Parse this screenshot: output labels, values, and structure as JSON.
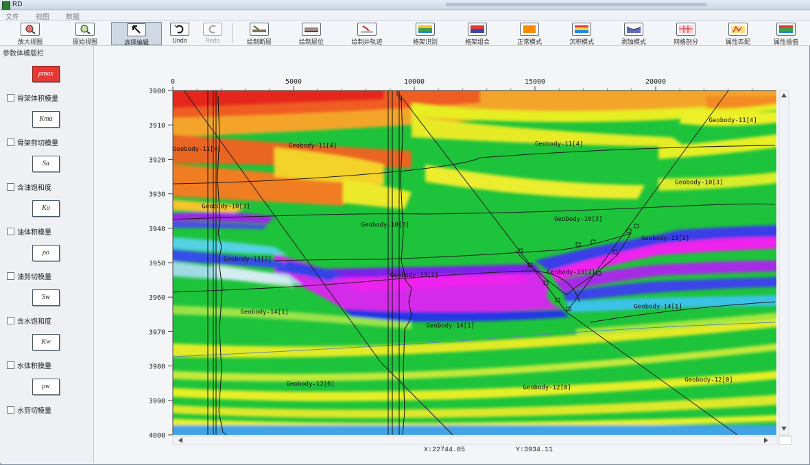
{
  "window": {
    "title": "RD"
  },
  "menu": [
    "文件",
    "视图",
    "数据"
  ],
  "toolbar": {
    "items": [
      {
        "label": "放大视图",
        "icon": "zoom-in-icon"
      },
      {
        "label": "原始视图",
        "icon": "original-view-icon"
      },
      {
        "label": "选择编辑",
        "icon": "select-arrow-icon"
      },
      {
        "label": "Undo",
        "icon": "undo-icon"
      },
      {
        "label": "Redo",
        "icon": "redo-icon"
      },
      {
        "label": "绘制断层",
        "icon": "draw-fault-icon"
      },
      {
        "label": "绘制层位",
        "icon": "draw-horizon-icon"
      },
      {
        "label": "绘制井轨迹",
        "icon": "draw-well-track-icon"
      },
      {
        "label": "格架识别",
        "icon": "framework-recognition-icon"
      },
      {
        "label": "格架组合",
        "icon": "framework-combine-icon"
      },
      {
        "label": "正常模式",
        "icon": "normal-mode-icon"
      },
      {
        "label": "沉积模式",
        "icon": "sedimentary-mode-icon"
      },
      {
        "label": "剥蚀模式",
        "icon": "erosion-mode-icon"
      },
      {
        "label": "网格剖分",
        "icon": "mesh-subdivide-icon"
      },
      {
        "label": "属性匹配",
        "icon": "attribute-match-icon"
      },
      {
        "label": "属性插值",
        "icon": "attribute-interpolate-icon"
      }
    ]
  },
  "panel": {
    "title": "参数体模版栏",
    "top_button": "ρmax",
    "items": [
      {
        "label": "骨架体积模量",
        "button": "Kma"
      },
      {
        "label": "骨架剪切模量",
        "button": "Sa"
      },
      {
        "label": "含油饱和度",
        "button": "Ko"
      },
      {
        "label": "油体积模量",
        "button": "ρo"
      },
      {
        "label": "油剪切模量",
        "button": "Sw"
      },
      {
        "label": "含水饱和度",
        "button": "Kw"
      },
      {
        "label": "水体积模量",
        "button": "ρw"
      },
      {
        "label": "水剪切模量",
        "button": ""
      }
    ]
  },
  "chart_data": {
    "type": "seismic-section",
    "x_ticks": [
      "0",
      "5000",
      "10000",
      "15000",
      "20000"
    ],
    "xlim": [
      0,
      25000
    ],
    "y_ticks": [
      "3900",
      "3910",
      "3920",
      "3930",
      "3940",
      "3950",
      "3960",
      "3970",
      "3980",
      "3990",
      "4000"
    ],
    "ylim": [
      3900,
      4000
    ],
    "geobody_labels": [
      {
        "text": "Geobody-11[4]",
        "x": 0,
        "y": 3917.5
      },
      {
        "text": "Geobody-11[4]",
        "x": 4800,
        "y": 3916.5
      },
      {
        "text": "Geobody-11[4]",
        "x": 15000,
        "y": 3916
      },
      {
        "text": "Geobody-11[4]",
        "x": 22200,
        "y": 3909.2
      },
      {
        "text": "Geobody-10[3]",
        "x": 1200,
        "y": 3934.2
      },
      {
        "text": "Geobody-10[3]",
        "x": 7800,
        "y": 3939.5
      },
      {
        "text": "Geobody-10[3]",
        "x": 15800,
        "y": 3937.8
      },
      {
        "text": "Geobody-10[3]",
        "x": 20800,
        "y": 3927.2
      },
      {
        "text": "Geobody-13[2]",
        "x": 2100,
        "y": 3949.5
      },
      {
        "text": "Geobody-13[2]",
        "x": 9000,
        "y": 3954.2
      },
      {
        "text": "Geobody-13[2]",
        "x": 15500,
        "y": 3953.3
      },
      {
        "text": "Geobody-13[2]",
        "x": 19400,
        "y": 3943.4
      },
      {
        "text": "Geobody-14[1]",
        "x": 2800,
        "y": 3964.8
      },
      {
        "text": "Geobody-14[1]",
        "x": 10500,
        "y": 3968.8
      },
      {
        "text": "Geobody-14[1]",
        "x": 19100,
        "y": 3963.2
      },
      {
        "text": "Geobody-12[0]",
        "x": 4700,
        "y": 3985.8
      },
      {
        "text": "Geobody-12[0]",
        "x": 14500,
        "y": 3986.8
      },
      {
        "text": "Geobody-12[0]",
        "x": 21200,
        "y": 3984.6
      }
    ]
  },
  "status": {
    "x_readout": "X:22744.05",
    "y_readout": "Y:3934.11"
  },
  "colors": {
    "red": "#e4201c",
    "orange": "#f5841f",
    "yellow": "#e4ee1a",
    "green": "#19c13a",
    "cyan": "#52d6e8",
    "blue": "#1933e6",
    "purple": "#8e25e8",
    "magenta": "#ef1ef2"
  }
}
